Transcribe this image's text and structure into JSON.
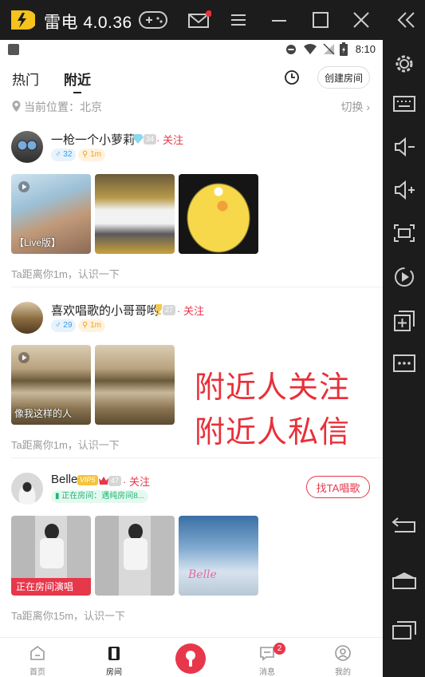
{
  "emulator": {
    "title": "雷电 4.0.36",
    "titlebar_buttons": [
      "gamepad-icon",
      "mail-icon",
      "menu-icon",
      "minimize-icon",
      "maximize-icon",
      "close-icon",
      "collapse-icon"
    ],
    "sidebar_buttons": [
      "settings-icon",
      "keyboard-icon",
      "volume-down-icon",
      "volume-up-icon",
      "fullscreen-icon",
      "rotate-icon",
      "add-window-icon",
      "more-icon",
      "back-icon",
      "home-icon",
      "recent-apps-icon"
    ]
  },
  "statusbar": {
    "time": "8:10"
  },
  "header": {
    "tabs": [
      "热门",
      "附近"
    ],
    "active_tab": "附近",
    "create_room": "创建房间"
  },
  "location": {
    "label": "当前位置：北京",
    "switch": "切换"
  },
  "cards": [
    {
      "name": "一枪一个小萝莉",
      "level": "34",
      "follow": "· 关注",
      "chip_1": "32",
      "chip_2": "1m",
      "thumb_label": "【Live版】",
      "distance": "Ta距离你1m，认识一下"
    },
    {
      "name": "喜欢唱歌的小哥哥哟",
      "level": "27",
      "follow": "· 关注",
      "chip_1": "29",
      "chip_2": "1m",
      "thumb_label": "像我这样的人",
      "distance": "Ta距离你1m，认识一下"
    },
    {
      "name": "Belle",
      "vip": "VIP5",
      "level": "47",
      "follow": "· 关注",
      "status": "正在房间：遇纯房间8...",
      "sing_button": "找TA唱歌",
      "thumb_label": "正在房间演唱",
      "thumb_text": "Belle",
      "distance": "Ta距离你15m，认识一下"
    }
  ],
  "overlay": {
    "line1": "附近人关注",
    "line2": "附近人私信"
  },
  "bottom_nav": {
    "items": [
      "首页",
      "房间",
      "",
      "消息",
      "我的"
    ],
    "active": "房间",
    "badge": "2"
  },
  "colors": {
    "accent": "#e7374b",
    "overlay": "#e8303a"
  }
}
